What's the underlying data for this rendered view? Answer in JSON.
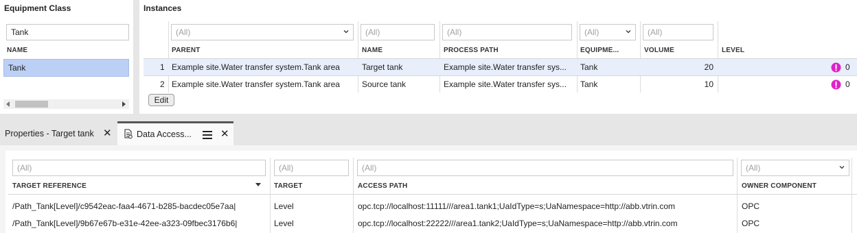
{
  "equipment_class": {
    "title": "Equipment Class",
    "filter_value": "Tank",
    "name_header": "NAME",
    "items": [
      "Tank"
    ]
  },
  "instances": {
    "title": "Instances",
    "filters": {
      "parent": "(All)",
      "name": "(All)",
      "process_path": "(All)",
      "equipment": "(All)",
      "volume": "(All)"
    },
    "headers": [
      "PARENT",
      "NAME",
      "PROCESS PATH",
      "EQUIPME...",
      "VOLUME",
      "LEVEL"
    ],
    "rows": [
      {
        "num": "1",
        "parent": "Example site.Water transfer system.Tank area",
        "name": "Target tank",
        "process_path": "Example site.Water transfer sys...",
        "equipment": "Tank",
        "volume": "20",
        "level": "0"
      },
      {
        "num": "2",
        "parent": "Example site.Water transfer system.Tank area",
        "name": "Source tank",
        "process_path": "Example site.Water transfer sys...",
        "equipment": "Tank",
        "volume": "10",
        "level": "0"
      }
    ],
    "edit_label": "Edit"
  },
  "tabs": {
    "properties_label": "Properties - Target tank",
    "data_access_label": "Data Access..."
  },
  "data_access": {
    "filters": {
      "target_reference": "(All)",
      "target": "(All)",
      "access_path": "(All)",
      "owner_component": "(All)"
    },
    "headers": [
      "TARGET REFERENCE",
      "TARGET",
      "ACCESS PATH",
      "OWNER COMPONENT"
    ],
    "rows": [
      {
        "target_reference": "/Path_Tank[Level]/c9542eac-faa4-4671-b285-bacdec05e7aa|",
        "target": "Level",
        "access_path": "opc.tcp://localhost:11111///area1.tank1;UaIdType=s;UaNamespace=http://abb.vtrin.com",
        "owner": "OPC"
      },
      {
        "target_reference": "/Path_Tank[Level]/9b67e67b-e31e-42ee-a323-09fbec3176b6|",
        "target": "Level",
        "access_path": "opc.tcp://localhost:22222///area1.tank2;UaIdType=s;UaNamespace=http://abb.vtrin.com",
        "owner": "OPC"
      }
    ]
  },
  "colors": {
    "selected_row": "#bcd0f5",
    "hover_row": "#e8eefa",
    "alert_icon": "#e020c8",
    "tab_active_border": "#555555"
  }
}
